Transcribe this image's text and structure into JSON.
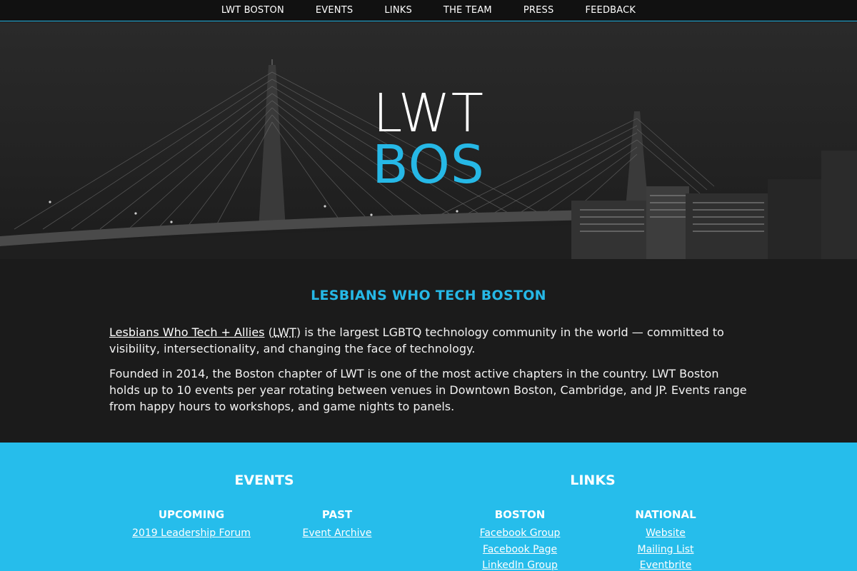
{
  "nav": {
    "items": [
      "LWT BOSTON",
      "EVENTS",
      "LINKS",
      "THE TEAM",
      "PRESS",
      "FEEDBACK"
    ]
  },
  "hero": {
    "line1": "LWT",
    "line2": "BOS"
  },
  "about": {
    "heading": "LESBIANS WHO TECH BOSTON",
    "p1_link": "Lesbians Who Tech + Allies",
    "p1_open": " (",
    "p1_abbr": "LWT",
    "p1_rest": ") is the largest LGBTQ technology community in the world — committed to visibility, intersectionality, and changing the face of technology.",
    "p2": "Founded in 2014, the Boston chapter of LWT is one of the most active chapters in the country. LWT Boston holds up to 10 events per year rotating between venues in Downtown Boston, Cambridge, and JP. Events range from happy hours to workshops, and game nights to panels."
  },
  "links": {
    "events_title": "EVENTS",
    "links_title": "LINKS",
    "upcoming": {
      "title": "UPCOMING",
      "items": [
        "2019 Leadership Forum"
      ]
    },
    "past": {
      "title": "PAST",
      "items": [
        "Event Archive"
      ]
    },
    "boston": {
      "title": "BOSTON",
      "items": [
        "Facebook Group",
        "Facebook Page",
        "LinkedIn Group"
      ]
    },
    "national": {
      "title": "NATIONAL",
      "items": [
        "Website",
        "Mailing List",
        "Eventbrite"
      ]
    }
  },
  "colors": {
    "accent": "#26b8e6",
    "accent_bg": "#26bdeb",
    "dark": "#1b1b1b"
  }
}
